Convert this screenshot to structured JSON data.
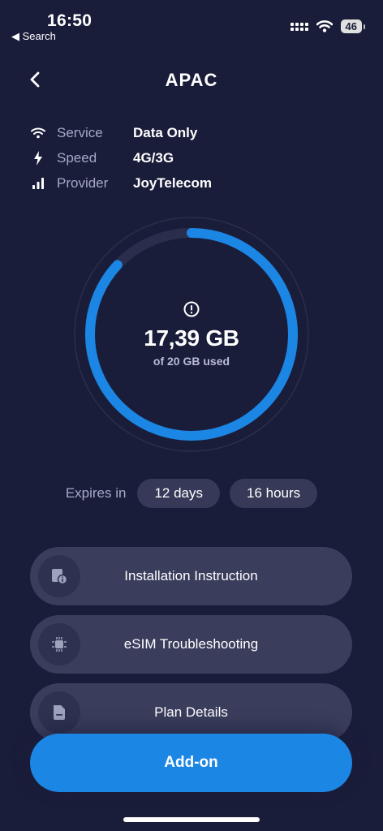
{
  "status_bar": {
    "time": "16:50",
    "back_app": "◀ Search",
    "battery": "46"
  },
  "header": {
    "title": "APAC"
  },
  "info": [
    {
      "icon": "wifi-icon",
      "label": "Service",
      "value": "Data Only"
    },
    {
      "icon": "bolt-icon",
      "label": "Speed",
      "value": "4G/3G"
    },
    {
      "icon": "signal-bars-icon",
      "label": "Provider",
      "value": "JoyTelecom"
    }
  ],
  "usage": {
    "amount": "17,39 GB",
    "caption": "of 20 GB used",
    "used_gb": 17.39,
    "total_gb": 20,
    "ring_color": "#1b86e3",
    "track_color": "#2a2d4b"
  },
  "expiry": {
    "label": "Expires in",
    "days": "12 days",
    "hours": "16 hours"
  },
  "cards": [
    {
      "icon": "document-info-icon",
      "label": "Installation Instruction"
    },
    {
      "icon": "chip-icon",
      "label": "eSIM Troubleshooting"
    },
    {
      "icon": "file-icon",
      "label": "Plan Details"
    }
  ],
  "addon": {
    "label": "Add-on"
  },
  "colors": {
    "background": "#1a1d3a",
    "accent": "#1b86e3",
    "card": "#3a3d5c"
  }
}
